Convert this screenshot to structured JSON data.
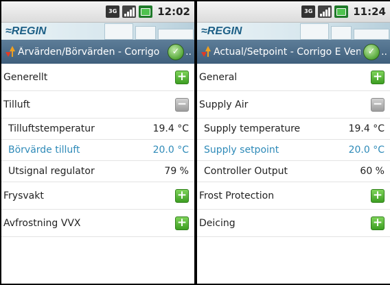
{
  "phones": [
    {
      "status": {
        "network": "3G",
        "time": "12:02"
      },
      "logo": "≈REGIN",
      "title": "Ärvärden/Börvärden - Corrigo",
      "ellipsis": "..",
      "groups": [
        {
          "label": "Generellt",
          "expanded": false
        },
        {
          "label": "Tilluft",
          "expanded": true
        },
        {
          "label": "Frysvakt",
          "expanded": false
        },
        {
          "label": "Avfrostning VVX",
          "expanded": false
        }
      ],
      "items": [
        {
          "label": "Tilluftstemperatur",
          "value": "19.4 °C"
        },
        {
          "label": "Börvärde tilluft",
          "value": "20.0 °C",
          "highlight": true
        },
        {
          "label": "Utsignal regulator",
          "value": "79 %"
        }
      ]
    },
    {
      "status": {
        "network": "3G",
        "time": "11:24"
      },
      "logo": "≈REGIN",
      "title": "Actual/Setpoint - Corrigo E Ven",
      "ellipsis": "..",
      "groups": [
        {
          "label": "General",
          "expanded": false
        },
        {
          "label": "Supply Air",
          "expanded": true
        },
        {
          "label": "Frost Protection",
          "expanded": false
        },
        {
          "label": "Deicing",
          "expanded": false
        }
      ],
      "items": [
        {
          "label": "Supply temperature",
          "value": "19.4 °C"
        },
        {
          "label": "Supply setpoint",
          "value": "20.0 °C",
          "highlight": true
        },
        {
          "label": "Controller Output",
          "value": "60 %"
        }
      ]
    }
  ],
  "icons": {
    "expand": "+",
    "collapse": "−",
    "back": "✓"
  },
  "colors": {
    "highlight": "#2e8ab8",
    "plus": "#4caf2a",
    "title_bar": "#4b6b88"
  }
}
